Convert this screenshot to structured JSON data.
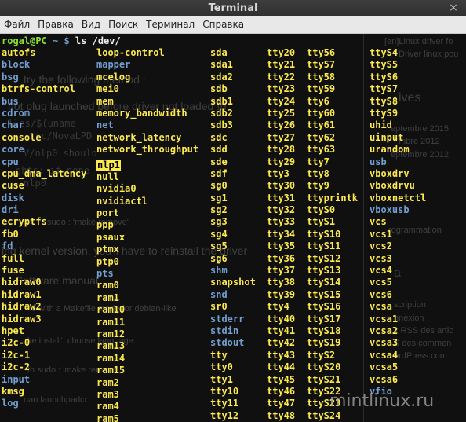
{
  "window": {
    "title": "Terminal",
    "close_icon": "×"
  },
  "menu": {
    "items": [
      "Файл",
      "Правка",
      "Вид",
      "Поиск",
      "Терминал",
      "Справка"
    ]
  },
  "prompt": {
    "user_host": "rogal@PC",
    "path": " ~ $",
    "command": " ls /dev/"
  },
  "listing": {
    "col1": [
      {
        "t": "autofs",
        "c": "y"
      },
      {
        "t": "block",
        "c": "b"
      },
      {
        "t": "bsg",
        "c": "b"
      },
      {
        "t": "btrfs-control",
        "c": "y"
      },
      {
        "t": "bus",
        "c": "b"
      },
      {
        "t": "cdrom",
        "c": "b"
      },
      {
        "t": "char",
        "c": "b"
      },
      {
        "t": "console",
        "c": "y"
      },
      {
        "t": "core",
        "c": "b"
      },
      {
        "t": "cpu",
        "c": "b"
      },
      {
        "t": "cpu_dma_latency",
        "c": "y"
      },
      {
        "t": "cuse",
        "c": "y"
      },
      {
        "t": "disk",
        "c": "b"
      },
      {
        "t": "dri",
        "c": "b"
      },
      {
        "t": "ecryptfs",
        "c": "y"
      },
      {
        "t": "fb0",
        "c": "y"
      },
      {
        "t": "fd",
        "c": "b"
      },
      {
        "t": "full",
        "c": "y"
      },
      {
        "t": "fuse",
        "c": "y"
      },
      {
        "t": "hidraw0",
        "c": "y"
      },
      {
        "t": "hidraw1",
        "c": "y"
      },
      {
        "t": "hidraw2",
        "c": "y"
      },
      {
        "t": "hidraw3",
        "c": "y"
      },
      {
        "t": "hpet",
        "c": "y"
      },
      {
        "t": "i2c-0",
        "c": "y"
      },
      {
        "t": "i2c-1",
        "c": "y"
      },
      {
        "t": "i2c-2",
        "c": "y"
      },
      {
        "t": "input",
        "c": "b"
      },
      {
        "t": "kmsg",
        "c": "y"
      },
      {
        "t": "log",
        "c": "b"
      }
    ],
    "col2": [
      {
        "t": "loop-control",
        "c": "y"
      },
      {
        "t": "mapper",
        "c": "b"
      },
      {
        "t": "mcelog",
        "c": "y"
      },
      {
        "t": "mei0",
        "c": "y"
      },
      {
        "t": "mem",
        "c": "y"
      },
      {
        "t": "memory_bandwidth",
        "c": "y"
      },
      {
        "t": "net",
        "c": "b"
      },
      {
        "t": "network_latency",
        "c": "y"
      },
      {
        "t": "network_throughput",
        "c": "y"
      },
      {
        "t": "nlp1",
        "c": "h"
      },
      {
        "t": "null",
        "c": "y"
      },
      {
        "t": "nvidia0",
        "c": "y"
      },
      {
        "t": "nvidiactl",
        "c": "y"
      },
      {
        "t": "port",
        "c": "y"
      },
      {
        "t": "ppp",
        "c": "y"
      },
      {
        "t": "psaux",
        "c": "y"
      },
      {
        "t": "ptmx",
        "c": "y"
      },
      {
        "t": "ptp0",
        "c": "y"
      },
      {
        "t": "pts",
        "c": "b"
      },
      {
        "t": "ram0",
        "c": "y"
      },
      {
        "t": "ram1",
        "c": "y"
      },
      {
        "t": "ram10",
        "c": "y"
      },
      {
        "t": "ram11",
        "c": "y"
      },
      {
        "t": "ram12",
        "c": "y"
      },
      {
        "t": "ram13",
        "c": "y"
      },
      {
        "t": "ram14",
        "c": "y"
      },
      {
        "t": "ram15",
        "c": "y"
      },
      {
        "t": "ram2",
        "c": "y"
      },
      {
        "t": "ram3",
        "c": "y"
      },
      {
        "t": "ram4",
        "c": "y"
      },
      {
        "t": "ram5",
        "c": "y"
      }
    ],
    "col3": [
      {
        "t": "sda",
        "c": "y"
      },
      {
        "t": "sda1",
        "c": "y"
      },
      {
        "t": "sda2",
        "c": "y"
      },
      {
        "t": "sdb",
        "c": "y"
      },
      {
        "t": "sdb1",
        "c": "y"
      },
      {
        "t": "sdb2",
        "c": "y"
      },
      {
        "t": "sdb3",
        "c": "y"
      },
      {
        "t": "sdc",
        "c": "y"
      },
      {
        "t": "sdd",
        "c": "y"
      },
      {
        "t": "sde",
        "c": "y"
      },
      {
        "t": "sdf",
        "c": "y"
      },
      {
        "t": "sg0",
        "c": "y"
      },
      {
        "t": "sg1",
        "c": "y"
      },
      {
        "t": "sg2",
        "c": "y"
      },
      {
        "t": "sg3",
        "c": "y"
      },
      {
        "t": "sg4",
        "c": "y"
      },
      {
        "t": "sg5",
        "c": "y"
      },
      {
        "t": "sg6",
        "c": "y"
      },
      {
        "t": "shm",
        "c": "b"
      },
      {
        "t": "snapshot",
        "c": "y"
      },
      {
        "t": "snd",
        "c": "b"
      },
      {
        "t": "sr0",
        "c": "y"
      },
      {
        "t": "stderr",
        "c": "b"
      },
      {
        "t": "stdin",
        "c": "b"
      },
      {
        "t": "stdout",
        "c": "b"
      },
      {
        "t": "tty",
        "c": "y"
      },
      {
        "t": "tty0",
        "c": "y"
      },
      {
        "t": "tty1",
        "c": "y"
      },
      {
        "t": "tty10",
        "c": "y"
      },
      {
        "t": "tty11",
        "c": "y"
      },
      {
        "t": "tty12",
        "c": "y"
      }
    ],
    "col4": [
      {
        "t": "tty20",
        "c": "y"
      },
      {
        "t": "tty21",
        "c": "y"
      },
      {
        "t": "tty22",
        "c": "y"
      },
      {
        "t": "tty23",
        "c": "y"
      },
      {
        "t": "tty24",
        "c": "y"
      },
      {
        "t": "tty25",
        "c": "y"
      },
      {
        "t": "tty26",
        "c": "y"
      },
      {
        "t": "tty27",
        "c": "y"
      },
      {
        "t": "tty28",
        "c": "y"
      },
      {
        "t": "tty29",
        "c": "y"
      },
      {
        "t": "tty3",
        "c": "y"
      },
      {
        "t": "tty30",
        "c": "y"
      },
      {
        "t": "tty31",
        "c": "y"
      },
      {
        "t": "tty32",
        "c": "y"
      },
      {
        "t": "tty33",
        "c": "y"
      },
      {
        "t": "tty34",
        "c": "y"
      },
      {
        "t": "tty35",
        "c": "y"
      },
      {
        "t": "tty36",
        "c": "y"
      },
      {
        "t": "tty37",
        "c": "y"
      },
      {
        "t": "tty38",
        "c": "y"
      },
      {
        "t": "tty39",
        "c": "y"
      },
      {
        "t": "tty4",
        "c": "y"
      },
      {
        "t": "tty40",
        "c": "y"
      },
      {
        "t": "tty41",
        "c": "y"
      },
      {
        "t": "tty42",
        "c": "y"
      },
      {
        "t": "tty43",
        "c": "y"
      },
      {
        "t": "tty44",
        "c": "y"
      },
      {
        "t": "tty45",
        "c": "y"
      },
      {
        "t": "tty46",
        "c": "y"
      },
      {
        "t": "tty47",
        "c": "y"
      },
      {
        "t": "tty48",
        "c": "y"
      }
    ],
    "col5": [
      {
        "t": "tty56",
        "c": "y"
      },
      {
        "t": "tty57",
        "c": "y"
      },
      {
        "t": "tty58",
        "c": "y"
      },
      {
        "t": "tty59",
        "c": "y"
      },
      {
        "t": "tty6",
        "c": "y"
      },
      {
        "t": "tty60",
        "c": "y"
      },
      {
        "t": "tty61",
        "c": "y"
      },
      {
        "t": "tty62",
        "c": "y"
      },
      {
        "t": "tty63",
        "c": "y"
      },
      {
        "t": "tty7",
        "c": "y"
      },
      {
        "t": "tty8",
        "c": "y"
      },
      {
        "t": "tty9",
        "c": "y"
      },
      {
        "t": "ttyprintk",
        "c": "y"
      },
      {
        "t": "ttyS0",
        "c": "y"
      },
      {
        "t": "ttyS1",
        "c": "y"
      },
      {
        "t": "ttyS10",
        "c": "y"
      },
      {
        "t": "ttyS11",
        "c": "y"
      },
      {
        "t": "ttyS12",
        "c": "y"
      },
      {
        "t": "ttyS13",
        "c": "y"
      },
      {
        "t": "ttyS14",
        "c": "y"
      },
      {
        "t": "ttyS15",
        "c": "y"
      },
      {
        "t": "ttyS16",
        "c": "y"
      },
      {
        "t": "ttyS17",
        "c": "y"
      },
      {
        "t": "ttyS18",
        "c": "y"
      },
      {
        "t": "ttyS19",
        "c": "y"
      },
      {
        "t": "ttyS2",
        "c": "y"
      },
      {
        "t": "ttyS20",
        "c": "y"
      },
      {
        "t": "ttyS21",
        "c": "y"
      },
      {
        "t": "ttyS22",
        "c": "y"
      },
      {
        "t": "ttyS23",
        "c": "y"
      },
      {
        "t": "ttyS24",
        "c": "y"
      }
    ],
    "col6": [
      {
        "t": "ttyS4",
        "c": "y"
      },
      {
        "t": "ttyS5",
        "c": "y"
      },
      {
        "t": "ttyS6",
        "c": "y"
      },
      {
        "t": "ttyS7",
        "c": "y"
      },
      {
        "t": "ttyS8",
        "c": "y"
      },
      {
        "t": "ttyS9",
        "c": "y"
      },
      {
        "t": "uhid",
        "c": "y"
      },
      {
        "t": "uinput",
        "c": "y"
      },
      {
        "t": "urandom",
        "c": "y"
      },
      {
        "t": "usb",
        "c": "b"
      },
      {
        "t": "vboxdrv",
        "c": "y"
      },
      {
        "t": "vboxdrvu",
        "c": "y"
      },
      {
        "t": "vboxnetctl",
        "c": "y"
      },
      {
        "t": "vboxusb",
        "c": "b"
      },
      {
        "t": "vcs",
        "c": "y"
      },
      {
        "t": "vcs1",
        "c": "y"
      },
      {
        "t": "vcs2",
        "c": "y"
      },
      {
        "t": "vcs3",
        "c": "y"
      },
      {
        "t": "vcs4",
        "c": "y"
      },
      {
        "t": "vcs5",
        "c": "y"
      },
      {
        "t": "vcs6",
        "c": "y"
      },
      {
        "t": "vcsa",
        "c": "y"
      },
      {
        "t": "vcsa1",
        "c": "y"
      },
      {
        "t": "vcsa2",
        "c": "y"
      },
      {
        "t": "vcsa3",
        "c": "y"
      },
      {
        "t": "vcsa4",
        "c": "y"
      },
      {
        "t": "vcsa5",
        "c": "y"
      },
      {
        "t": "vcsa6",
        "c": "y"
      },
      {
        "t": "vfio",
        "c": "b"
      }
    ]
  },
  "background_text": {
    "a": "try the following method :",
    "b": "hot plug launched before driver not loaded !!)",
    "c": "lles/$(uname",
    "d": "sc/NovaLPD",
    "e": "V/nlp0 should",
    "f": "ghts: if none",
    "g": "nlp0",
    "h": "sudo : 'make remove'",
    "i": "ing kernel version, you'll have to reinstall the driver",
    "j": "Software manual",
    "k": "e with a Makefile made for debian-like",
    "l": "ke install', choose language.",
    "m": "th sudo : 'make remove'",
    "n": "nan launchpadcr",
    "r1": "[en]Linux driver fo",
    "r2": "Driver linux pou",
    "r3": "ives",
    "r4": "eptembre 2015",
    "r5": "mbre 2012",
    "r6": "eptembre 2012",
    "r7": "rogrammation",
    "r8": "a",
    "r9": "scription",
    "r10": "nnexion",
    "r11": "x RSS des artic",
    "r12": "S des commen",
    "r13": "ordPress.com"
  },
  "watermark": "mintlinux.ru"
}
